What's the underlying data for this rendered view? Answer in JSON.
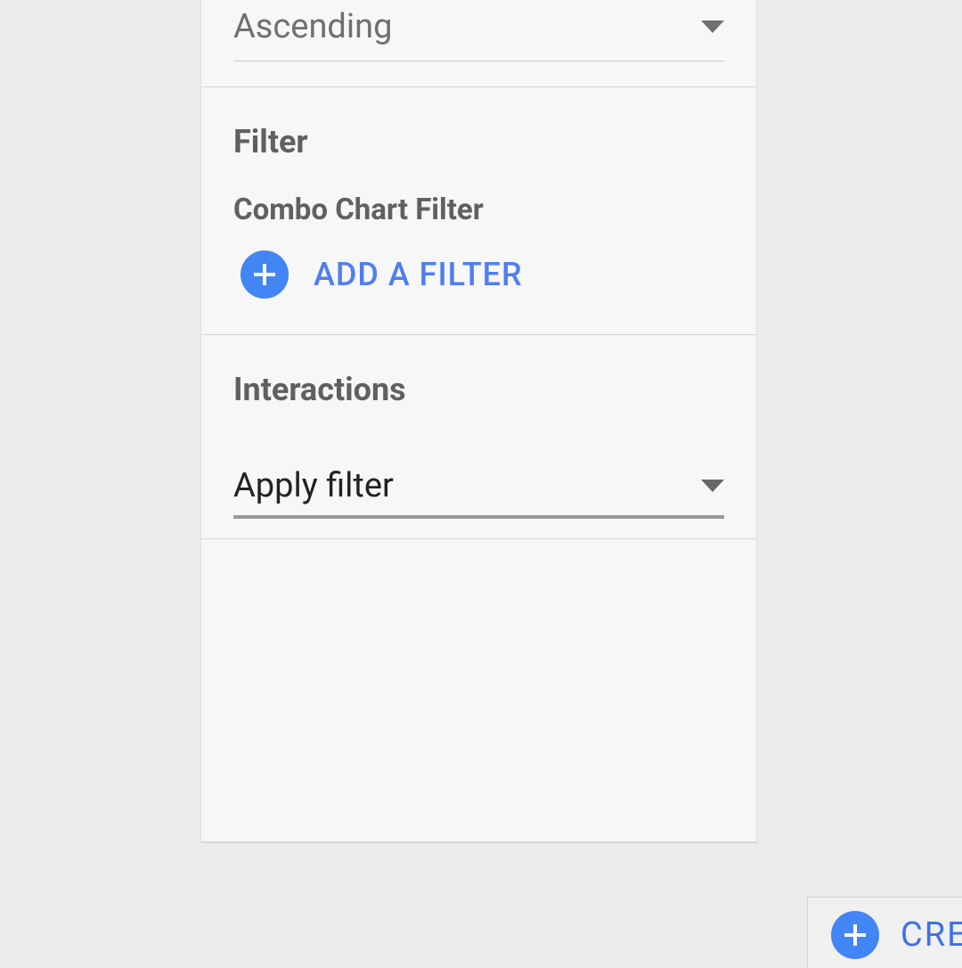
{
  "sort": {
    "selected": "Ascending"
  },
  "filter": {
    "heading": "Filter",
    "subheading": "Combo Chart Filter",
    "add_button_label": "ADD A FILTER"
  },
  "interactions": {
    "heading": "Interactions",
    "selected": "Apply filter"
  },
  "bottom_button": {
    "label_partial": "CRE"
  },
  "colors": {
    "accent_blue": "#4285f4",
    "link_blue": "#4e7ef2"
  }
}
